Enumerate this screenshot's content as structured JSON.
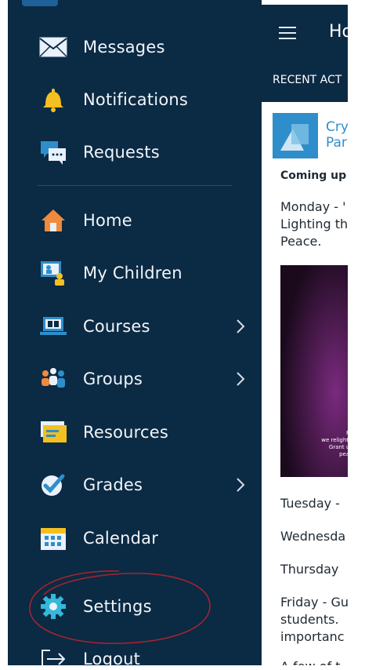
{
  "drawer": {
    "items": [
      {
        "name": "messages",
        "label": "Messages",
        "icon": "envelope-icon",
        "has_chevron": false
      },
      {
        "name": "notifications",
        "label": "Notifications",
        "icon": "bell-icon",
        "has_chevron": false
      },
      {
        "name": "requests",
        "label": "Requests",
        "icon": "chat-bubbles-icon",
        "has_chevron": false
      },
      {
        "name": "home",
        "label": "Home",
        "icon": "house-icon",
        "has_chevron": false
      },
      {
        "name": "my-children",
        "label": "My Children",
        "icon": "children-icon",
        "has_chevron": false
      },
      {
        "name": "courses",
        "label": "Courses",
        "icon": "laptop-book-icon",
        "has_chevron": true
      },
      {
        "name": "groups",
        "label": "Groups",
        "icon": "people-group-icon",
        "has_chevron": true
      },
      {
        "name": "resources",
        "label": "Resources",
        "icon": "folder-icon",
        "has_chevron": false
      },
      {
        "name": "grades",
        "label": "Grades",
        "icon": "checkmark-badge-icon",
        "has_chevron": true
      },
      {
        "name": "calendar",
        "label": "Calendar",
        "icon": "calendar-icon",
        "has_chevron": false
      },
      {
        "name": "settings",
        "label": "Settings",
        "icon": "gear-icon",
        "has_chevron": false
      },
      {
        "name": "logout",
        "label": "Logout",
        "icon": "logout-arrow-icon",
        "has_chevron": false
      }
    ],
    "annotation": "red hand-drawn circle around Settings"
  },
  "main": {
    "title": "Ho",
    "tab": "RECENT ACT",
    "course_name_line1": "Cry",
    "course_name_line2": "Par",
    "coming_up": "Coming up",
    "monday_line1": "Monday - '",
    "monday_line2": "Lighting th",
    "monday_line3": "Peace.",
    "image_text_1": "Fo",
    "image_text_2": "we relight t",
    "image_text_3": "Grant us",
    "image_text_4": "peac",
    "tuesday": "Tuesday -",
    "wednesday": "Wednesda",
    "thursday": "Thursday",
    "friday_line1": "Friday - Gu",
    "friday_line2": "students.",
    "friday_line3": "importanc",
    "bottom_cut": "A few of t"
  },
  "colors": {
    "drawer_bg": "#0b2a44",
    "text": "#f1f5f9",
    "accent_blue": "#2e8ecb",
    "annotation_red": "#a3242f"
  }
}
